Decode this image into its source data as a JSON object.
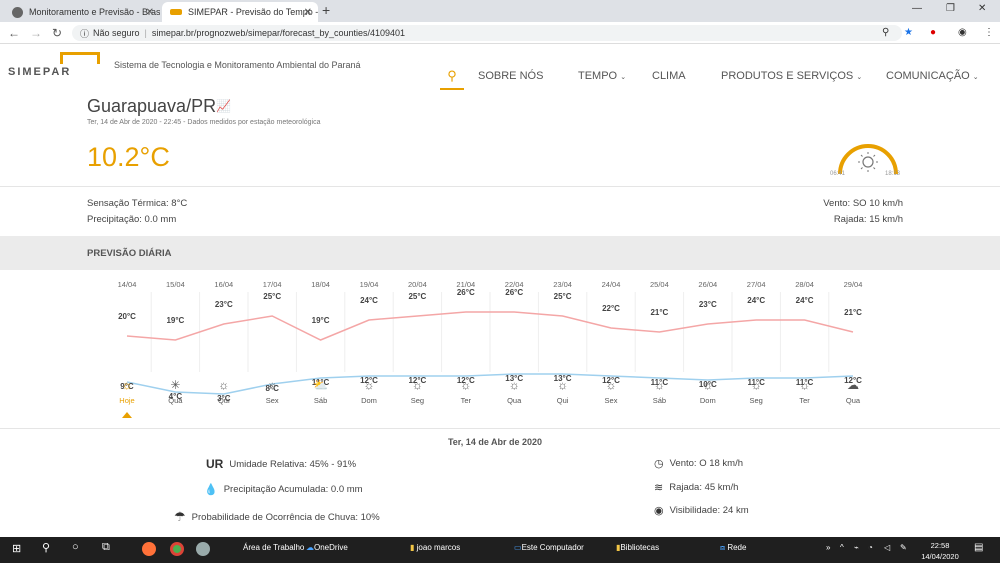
{
  "browser": {
    "tabs": [
      {
        "title": "Monitoramento e Previsão - Bras"
      },
      {
        "title": "SIMEPAR - Previsão do Tempo - "
      }
    ],
    "address": {
      "security": "Não seguro",
      "url": "simepar.br/prognozweb/simepar/forecast_by_counties/4109401"
    }
  },
  "site": {
    "logo_text": "SIMEPAR",
    "tagline": "Sistema de Tecnologia e Monitoramento Ambiental do Paraná",
    "menu": [
      "SOBRE NÓS",
      "TEMPO",
      "CLIMA",
      "PRODUTOS E SERVIÇOS",
      "COMUNICAÇÃO"
    ]
  },
  "current": {
    "city": "Guarapuava/PR",
    "datetime": "Ter, 14 de Abr de 2020 - 22:45 - Dados medidos por estação meteorológica",
    "temperature": "10.2°C",
    "sunrise": "06:41",
    "sunset": "18:13",
    "feels_like": "Sensação Térmica: 8°C",
    "precipitation": "Precipitação: 0.0 mm",
    "wind": "Vento: SO 10 km/h",
    "gust": "Rajada: 15 km/h"
  },
  "daily": {
    "title": "PREVISÃO DIÁRIA",
    "days": [
      {
        "date": "14/04",
        "max": "20°C",
        "min": "9°C",
        "day": "Hoje",
        "icon": "sun-icon"
      },
      {
        "date": "15/04",
        "max": "19°C",
        "min": "4°C",
        "day": "Qua",
        "icon": "frost-icon"
      },
      {
        "date": "16/04",
        "max": "23°C",
        "min": "3°C",
        "day": "Qui",
        "icon": "sun-icon"
      },
      {
        "date": "17/04",
        "max": "25°C",
        "min": "8°C",
        "day": "Sex",
        "icon": "sun-icon"
      },
      {
        "date": "18/04",
        "max": "19°C",
        "min": "11°C",
        "day": "Sáb",
        "icon": "partly-cloudy-icon"
      },
      {
        "date": "19/04",
        "max": "24°C",
        "min": "12°C",
        "day": "Dom",
        "icon": "sun-icon"
      },
      {
        "date": "20/04",
        "max": "25°C",
        "min": "12°C",
        "day": "Seg",
        "icon": "sun-icon"
      },
      {
        "date": "21/04",
        "max": "26°C",
        "min": "12°C",
        "day": "Ter",
        "icon": "sun-icon"
      },
      {
        "date": "22/04",
        "max": "26°C",
        "min": "13°C",
        "day": "Qua",
        "icon": "sun-icon"
      },
      {
        "date": "23/04",
        "max": "25°C",
        "min": "13°C",
        "day": "Qui",
        "icon": "sun-icon"
      },
      {
        "date": "24/04",
        "max": "22°C",
        "min": "12°C",
        "day": "Sex",
        "icon": "sun-icon"
      },
      {
        "date": "25/04",
        "max": "21°C",
        "min": "11°C",
        "day": "Sáb",
        "icon": "sun-icon"
      },
      {
        "date": "26/04",
        "max": "23°C",
        "min": "10°C",
        "day": "Dom",
        "icon": "sun-icon"
      },
      {
        "date": "27/04",
        "max": "24°C",
        "min": "11°C",
        "day": "Seg",
        "icon": "sun-icon"
      },
      {
        "date": "28/04",
        "max": "24°C",
        "min": "11°C",
        "day": "Ter",
        "icon": "sun-icon"
      },
      {
        "date": "29/04",
        "max": "21°C",
        "min": "12°C",
        "day": "Qua",
        "icon": "cloud-icon"
      }
    ],
    "max_values": [
      20,
      19,
      23,
      25,
      19,
      24,
      25,
      26,
      26,
      25,
      22,
      21,
      23,
      24,
      24,
      21
    ],
    "min_values": [
      9,
      4,
      3,
      8,
      11,
      12,
      12,
      12,
      13,
      13,
      12,
      11,
      10,
      11,
      11,
      12
    ],
    "colors": {
      "max": "#f4a6a6",
      "min": "#9fd0ee",
      "accent": "#e8a000"
    }
  },
  "detail": {
    "date": "Ter, 14 de Abr de 2020",
    "ur_icon": "UR",
    "humidity": "Umidade Relativa: 45% - 91%",
    "precip_acc": "Precipitação Acumulada: 0.0 mm",
    "rain_prob": "Probabilidade de Ocorrência de Chuva: 10%",
    "wind": "Vento: O 18 km/h",
    "gust": "Rajada: 45 km/h",
    "visibility": "Visibilidade: 24 km"
  },
  "taskbar": {
    "items": [
      "Área de Trabalho",
      "OneDrive",
      "joao marcos",
      "Este Computador",
      "Bibliotecas",
      "Rede"
    ],
    "time": "22:58",
    "date": "14/04/2020"
  }
}
